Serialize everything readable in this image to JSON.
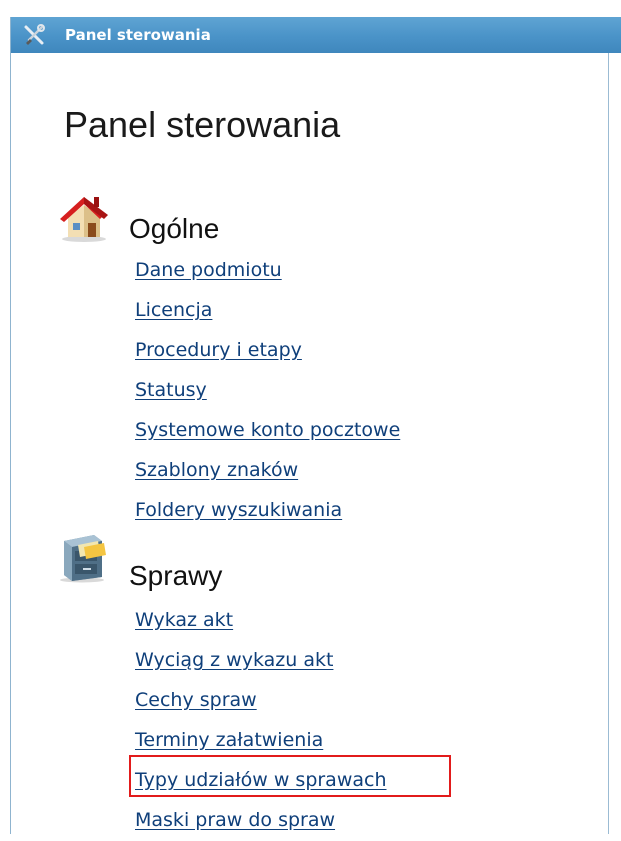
{
  "window": {
    "title": "Panel sterowania"
  },
  "page": {
    "title": "Panel sterowania"
  },
  "sections": [
    {
      "heading": "Ogólne",
      "icon": "house-icon",
      "links": [
        "Dane podmiotu",
        "Licencja",
        "Procedury i etapy",
        "Statusy",
        "Systemowe konto pocztowe",
        "Szablony znaków",
        "Foldery wyszukiwania"
      ]
    },
    {
      "heading": "Sprawy",
      "icon": "file-cabinet-icon",
      "links": [
        "Wykaz akt",
        "Wyciąg z wykazu akt",
        "Cechy spraw",
        "Terminy załatwienia",
        "Typy udziałów w sprawach",
        "Maski praw do spraw"
      ]
    }
  ],
  "colors": {
    "titlebar": "#4a93c8",
    "link": "#0f3f7a",
    "highlight": "#e21b1b"
  }
}
